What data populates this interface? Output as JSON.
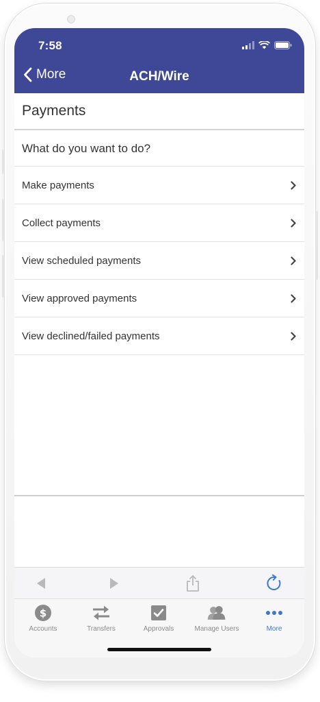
{
  "status_bar": {
    "time": "7:58"
  },
  "nav": {
    "back_label": "More",
    "title": "ACH/Wire"
  },
  "section": {
    "title": "Payments"
  },
  "prompt": "What do you want to do?",
  "menu": {
    "items": [
      {
        "label": "Make payments"
      },
      {
        "label": "Collect payments"
      },
      {
        "label": "View scheduled payments"
      },
      {
        "label": "View approved payments"
      },
      {
        "label": "View declined/failed payments"
      }
    ]
  },
  "tabs": [
    {
      "label": "Accounts",
      "icon": "dollar-circle-icon"
    },
    {
      "label": "Transfers",
      "icon": "transfer-arrows-icon"
    },
    {
      "label": "Approvals",
      "icon": "checkbox-icon"
    },
    {
      "label": "Manage Users",
      "icon": "users-icon"
    },
    {
      "label": "More",
      "icon": "more-dots-icon",
      "active": true
    }
  ],
  "colors": {
    "header": "#3e4896",
    "active_tab": "#3a78d4",
    "inactive_tab": "#8a8a8a"
  }
}
